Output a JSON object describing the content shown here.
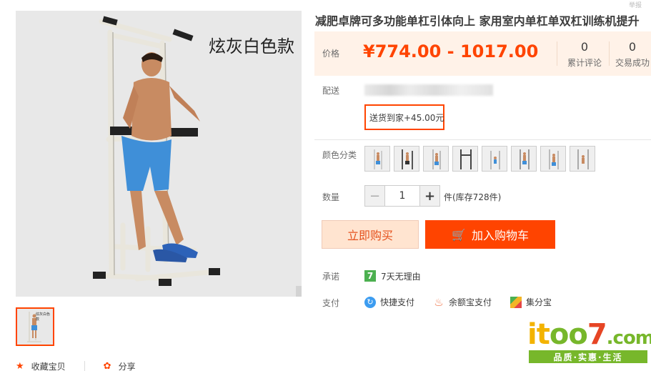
{
  "gallery": {
    "caption": "炫灰白色款",
    "zoom_icon": "magnifier-icon",
    "thumbnail_caption": "炫灰白色款"
  },
  "actions": {
    "favorite_label": "收藏宝贝",
    "favorite_icon": "star-icon",
    "share_label": "分享",
    "share_icon": "share-icon"
  },
  "product": {
    "top_edge_text": "举报",
    "title": "减肥卓牌可多功能单杠引体向上 家用室内单杠单双杠训练机提升",
    "price_label": "价格",
    "price": "¥774.00 - 1017.00",
    "stats": [
      {
        "num": "0",
        "label": "累计评论"
      },
      {
        "num": "0",
        "label": "交易成功"
      }
    ]
  },
  "shipping": {
    "label": "配送",
    "option": "送货到家+45.00元"
  },
  "color": {
    "label": "颜色分类",
    "swatch_count_visible": 8
  },
  "quantity": {
    "label": "数量",
    "value": "1",
    "minus": "−",
    "plus": "+",
    "stock_text": "件(库存728件)"
  },
  "buttons": {
    "buy_now": "立即购买",
    "add_to_cart": "加入购物车",
    "cart_icon": "cart-icon"
  },
  "promise": {
    "label": "承诺",
    "icon_text": "7",
    "text": "7天无理由"
  },
  "payment": {
    "label": "支付",
    "methods": [
      "快捷支付",
      "余额宝支付",
      "集分宝"
    ]
  },
  "watermark": {
    "logo_part1": "it",
    "logo_part2": "oo",
    "logo_part3": "7",
    "logo_part4": ".com",
    "slogan": "品质·实惠·生活"
  },
  "colors": {
    "accent": "#ff4400",
    "price_bg": "#fff2e8",
    "buy_bg": "#ffe4d0"
  }
}
